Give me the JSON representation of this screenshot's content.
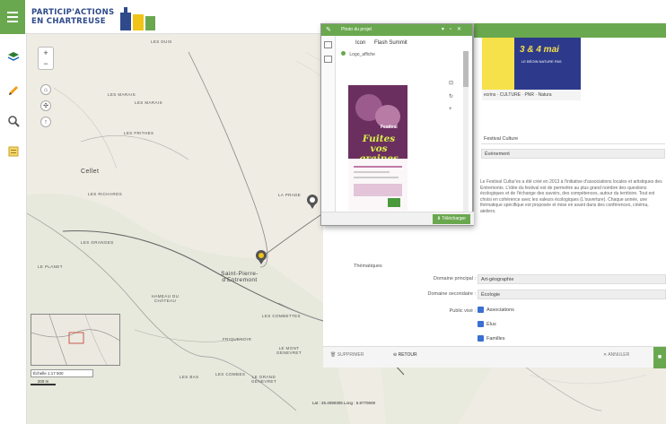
{
  "app": {
    "logo_line1": "PARTICIP'ACTIONS",
    "logo_line2": "EN CHARTREUSE"
  },
  "toolbar": {
    "icons": [
      "layers-icon",
      "pencil-icon",
      "search-icon",
      "document-icon"
    ]
  },
  "map": {
    "labels": [
      {
        "text": "LES DUIS"
      },
      {
        "text": "LES MARAIS"
      },
      {
        "text": "LES FRITHES"
      },
      {
        "text": "LES MARAIS"
      },
      {
        "text": "Cellet"
      },
      {
        "text": "LES RICHARDS"
      },
      {
        "text": "LA PRADE"
      },
      {
        "text": "LES GRANGES"
      },
      {
        "text": "LE PLANET"
      },
      {
        "text": "Saint-Pierre-d'Entremont"
      },
      {
        "text": "HAMEAU DU CHÂTEAU"
      },
      {
        "text": "LES COMBETTES"
      },
      {
        "text": "FRIQUENOIR"
      },
      {
        "text": "LE MONT GENEVRET"
      },
      {
        "text": "LES BAS"
      },
      {
        "text": "LES COMBES"
      },
      {
        "text": "LE GRAND GENEVRET"
      }
    ],
    "scale_text": "Échelle 1:17 500",
    "scale_bar": "200 m",
    "coords_text": "Lat : 45.4090305   Long : 5.8770609"
  },
  "popup": {
    "title": "Photo du projet",
    "tabs": [
      "Icon",
      "Flash Summit"
    ],
    "file_label": "Logo_affiche",
    "poster_title": "Fuites vos graines",
    "poster_top": "Festival",
    "download_label": "Télécharger"
  },
  "panel": {
    "banner_text": "3 & 4 mai",
    "banner_sub": "LE BÉOIN NATURE PAS",
    "strip_text": "ecrins  ·  CULTURE  ·  PNR  ·  Natura",
    "field_name": "Festival Culture",
    "field_type": "Évènement",
    "description": "Le Festival Cultur'es a été créé en 2013 à l'initiative d'associations locales et artistiques des Entremonts. L'idée du festival est de permettre au plus grand nombre des questions écologiques et de l'échange des savoirs, des compétences, autour du territoire. Tout est choisi en cohérence avec les valeurs écologiques (L'ouverture). Chaque année, une thématique spécifique est proposée et mise en avant dans des conférences, cinéma, ateliers.",
    "section_title": "Thématiques",
    "domain_label": "Domaine principal :",
    "domain_value": "Art-géographie",
    "secondary_label": "Domaine secondaire :",
    "secondary_value": "Écologie",
    "public_label": "Public visé :",
    "public_options": [
      "Associations",
      "Élus",
      "Familles"
    ],
    "delete_label": "SUPPRIMER",
    "return_label": "RETOUR",
    "cancel_label": "ANNULER"
  },
  "colors": {
    "accent": "#6aa84f",
    "logo_blue": "#2e4a8a",
    "check_blue": "#3b6fd1"
  }
}
